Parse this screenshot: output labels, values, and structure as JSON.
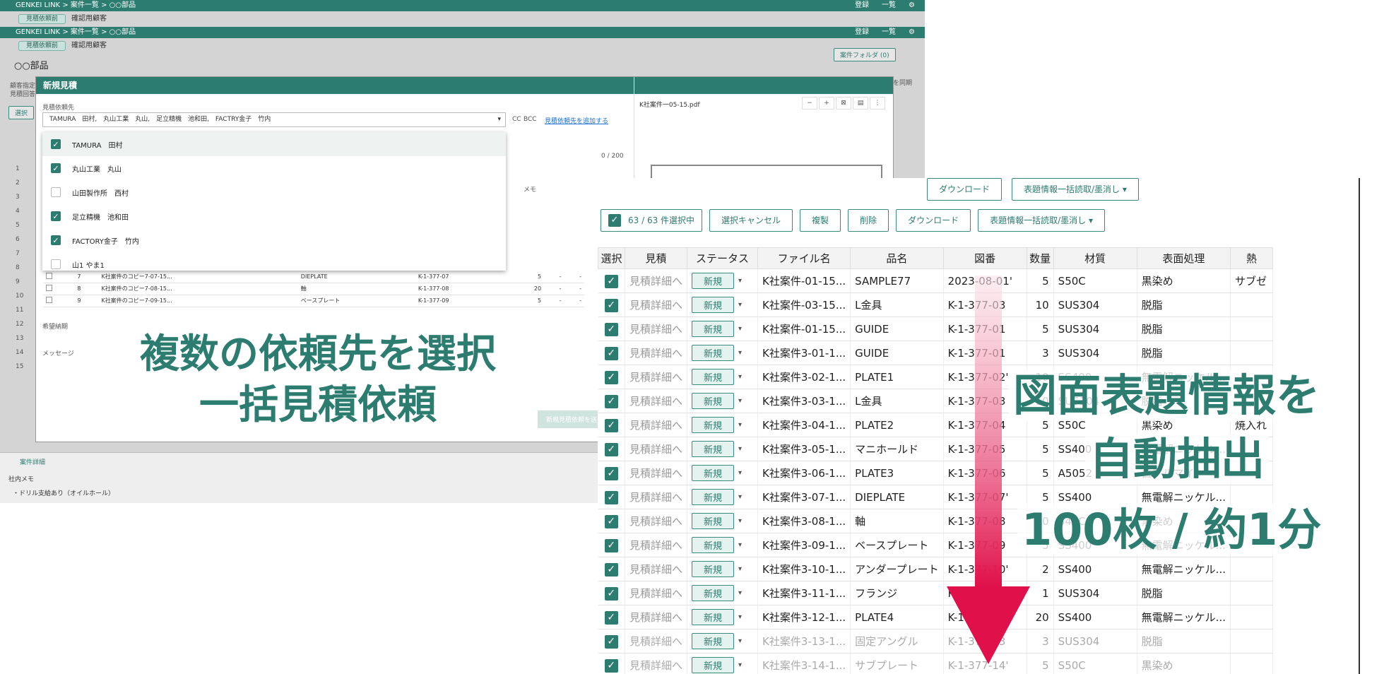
{
  "app": {
    "brand": "GENKEI LINK",
    "breadcrumb": [
      "案件一覧",
      "○○部品"
    ],
    "top_right": [
      "登録",
      "一覧"
    ],
    "stage_pill": "見積依頼前",
    "customer": "確認用顧客",
    "part_name": "○○部品",
    "folder_button": "案件フォルダ (0)",
    "sync_label": "を同期",
    "left_labels": [
      "顧客指定",
      "見積回答"
    ],
    "select_btn": "選択",
    "row_numbers": [
      "1",
      "2",
      "3",
      "4",
      "5",
      "6",
      "7",
      "8",
      "9",
      "10",
      "11",
      "12",
      "13",
      "14",
      "15"
    ],
    "tab_detail": "案件詳細",
    "memo_label": "社内メモ",
    "memo_text": "・ドリル支給あり（オイルホール）"
  },
  "modal": {
    "title": "新規見積",
    "recipient_label": "見積依頼先",
    "selected_text": "TAMURA　田村,　丸山工業　丸山,　足立精機　池和田,　FACTRY金子　竹内",
    "cc": "CC",
    "bcc": "BCC",
    "add_link": "見積依頼先を追加する",
    "counter": "0 / 200",
    "memo_col": "メモ",
    "options": [
      {
        "label": "TAMURA　田村",
        "checked": true
      },
      {
        "label": "丸山工業　丸山",
        "checked": true
      },
      {
        "label": "山田製作所　西村",
        "checked": false
      },
      {
        "label": "足立精機　池和田",
        "checked": true
      },
      {
        "label": "FACTORY金子　竹内",
        "checked": true
      },
      {
        "label": "山1 やま1",
        "checked": false
      }
    ],
    "mini_rows": [
      {
        "no": "7",
        "file": "K社案件のコピー7-07-15...",
        "name": "DIEPLATE",
        "drawing": "K-1-377-07",
        "qty": "5",
        "a": "-",
        "b": "-"
      },
      {
        "no": "8",
        "file": "K社案件のコピー7-08-15...",
        "name": "軸",
        "drawing": "K-1-377-08",
        "qty": "20",
        "a": "-",
        "b": "-"
      },
      {
        "no": "9",
        "file": "K社案件のコピー7-09-15...",
        "name": "ベースプレート",
        "drawing": "K-1-377-09",
        "qty": "5",
        "a": "-",
        "b": "-"
      }
    ],
    "date_label": "希望納期",
    "message_label": "メッセージ",
    "pdf_title": "K社案件一05-15.pdf",
    "submit": "新規見積依頼を送"
  },
  "right": {
    "selection_text": "63 / 63 件選択中",
    "buttons": [
      "選択キャンセル",
      "複製",
      "削除",
      "ダウンロード",
      "表題情報一括読取/墨消し ▾"
    ],
    "top_buttons": [
      "ダウンロード",
      "表題情報一括読取/墨消し ▾"
    ],
    "columns": [
      "選択",
      "見積",
      "ステータス",
      "ファイル名",
      "品名",
      "図番",
      "数量",
      "材質",
      "表面処理",
      "熱"
    ],
    "rows": [
      {
        "detail": "見積詳細へ",
        "status": "新規",
        "file": "K社案件-01-15...",
        "name": "SAMPLE77",
        "drawing": "2023-08-01'",
        "qty": "5",
        "material": "S50C",
        "surface": "黒染め",
        "heat": "サブゼ",
        "faded": false
      },
      {
        "detail": "見積詳細へ",
        "status": "新規",
        "file": "K社案件-03-15...",
        "name": "L金具",
        "drawing": "K-1-377-03",
        "qty": "10",
        "material": "SUS304",
        "surface": "脱脂",
        "heat": "",
        "faded": false
      },
      {
        "detail": "見積詳細へ",
        "status": "新規",
        "file": "K社案件-01-15...",
        "name": "GUIDE",
        "drawing": "K-1-377-01",
        "qty": "5",
        "material": "SUS304",
        "surface": "脱脂",
        "heat": "",
        "faded": false
      },
      {
        "detail": "見積詳細へ",
        "status": "新規",
        "file": "K社案件3-01-1...",
        "name": "GUIDE",
        "drawing": "K-1-377-01",
        "qty": "3",
        "material": "SUS304",
        "surface": "脱脂",
        "heat": "",
        "faded": false
      },
      {
        "detail": "見積詳細へ",
        "status": "新規",
        "file": "K社案件3-02-1...",
        "name": "PLATE1",
        "drawing": "K-1-377-02'",
        "qty": "10",
        "material": "SS400",
        "surface": "無電解ニッケル...",
        "heat": "",
        "faded": false
      },
      {
        "detail": "見積詳細へ",
        "status": "新規",
        "file": "K社案件3-03-1...",
        "name": "L金具",
        "drawing": "K-1-377-03",
        "qty": "10",
        "material": "SUS304",
        "surface": "脱脂",
        "heat": "",
        "faded": false
      },
      {
        "detail": "見積詳細へ",
        "status": "新規",
        "file": "K社案件3-04-1...",
        "name": "PLATE2",
        "drawing": "K-1-377-04",
        "qty": "5",
        "material": "S50C",
        "surface": "黒染め",
        "heat": "焼入れ",
        "faded": false
      },
      {
        "detail": "見積詳細へ",
        "status": "新規",
        "file": "K社案件3-05-1...",
        "name": "マニホールド",
        "drawing": "K-1-377-05",
        "qty": "5",
        "material": "SS400",
        "surface": "無電解ニッケル...",
        "heat": "",
        "faded": false
      },
      {
        "detail": "見積詳細へ",
        "status": "新規",
        "file": "K社案件3-06-1...",
        "name": "PLATE3",
        "drawing": "K-1-377-06",
        "qty": "5",
        "material": "A5052",
        "surface": "白アルマイト",
        "heat": "",
        "faded": false
      },
      {
        "detail": "見積詳細へ",
        "status": "新規",
        "file": "K社案件3-07-1...",
        "name": "DIEPLATE",
        "drawing": "K-1-377-07'",
        "qty": "5",
        "material": "SS400",
        "surface": "無電解ニッケル...",
        "heat": "",
        "faded": false
      },
      {
        "detail": "見積詳細へ",
        "status": "新規",
        "file": "K社案件3-08-1...",
        "name": "軸",
        "drawing": "K-1-377-08",
        "qty": "20",
        "material": "S45C",
        "surface": "黒染め",
        "heat": "",
        "faded": false
      },
      {
        "detail": "見積詳細へ",
        "status": "新規",
        "file": "K社案件3-09-1...",
        "name": "ベースプレート",
        "drawing": "K-1-377-09",
        "qty": "5",
        "material": "SS400",
        "surface": "無電解ニッケル...",
        "heat": "",
        "faded": false
      },
      {
        "detail": "見積詳細へ",
        "status": "新規",
        "file": "K社案件3-10-1...",
        "name": "アンダープレート",
        "drawing": "K-1-377-10'",
        "qty": "2",
        "material": "SS400",
        "surface": "無電解ニッケル...",
        "heat": "",
        "faded": false
      },
      {
        "detail": "見積詳細へ",
        "status": "新規",
        "file": "K社案件3-11-1...",
        "name": "フランジ",
        "drawing": "K-1-377-11",
        "qty": "1",
        "material": "SUS304",
        "surface": "脱脂",
        "heat": "",
        "faded": false
      },
      {
        "detail": "見積詳細へ",
        "status": "新規",
        "file": "K社案件3-12-1...",
        "name": "PLATE4",
        "drawing": "K-1-377-12'",
        "qty": "20",
        "material": "SS400",
        "surface": "無電解ニッケル...",
        "heat": "",
        "faded": false
      },
      {
        "detail": "見積詳細へ",
        "status": "新規",
        "file": "K社案件3-13-1...",
        "name": "固定アングル",
        "drawing": "K-1-377-13",
        "qty": "3",
        "material": "SUS304",
        "surface": "脱脂",
        "heat": "",
        "faded": true
      },
      {
        "detail": "見積詳細へ",
        "status": "新規",
        "file": "K社案件3-14-1...",
        "name": "サブプレート",
        "drawing": "K-1-377-14'",
        "qty": "5",
        "material": "S50C",
        "surface": "黒染め",
        "heat": "",
        "faded": true
      }
    ]
  },
  "captions": {
    "left_line1": "複数の依頼先を選択",
    "left_line2": "一括見積依頼",
    "right_line1": "図面表題情報を",
    "right_line2": "自動抽出",
    "right_line3": "100枚 / 約1分"
  },
  "colors": {
    "accent": "#2c7c70",
    "arrow_top": "#f7c6d3",
    "arrow_bottom": "#e0104a"
  }
}
